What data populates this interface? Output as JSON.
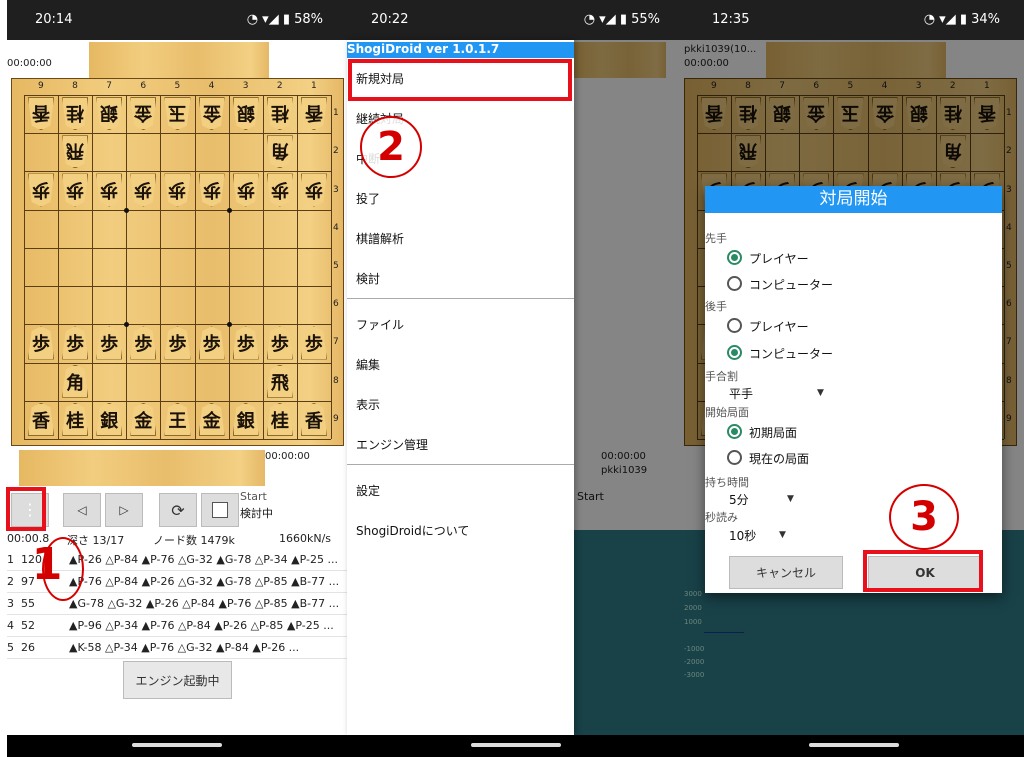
{
  "panel1": {
    "status_time": "20:14",
    "status_right": "◔ ▾◢ ▮ 58%",
    "top_clock": "00:00:00",
    "bottom_clock": "00:00:00",
    "analysis_status": "Start",
    "analysis_state": "検討中",
    "stats": {
      "time": "00:00.8",
      "depth": "深さ 13/17",
      "nodes": "ノード数 1479k",
      "nps": "1660kN/s"
    },
    "lines": [
      {
        "rank": "1",
        "score": "120",
        "moves": "▲P-26 △P-84 ▲P-76 △G-32 ▲G-78 △P-34 ▲P-25 ..."
      },
      {
        "rank": "2",
        "score": "97",
        "moves": "▲P-76 △P-84 ▲P-26 △G-32 ▲G-78 △P-85 ▲B-77 ..."
      },
      {
        "rank": "3",
        "score": "55",
        "moves": "▲G-78 △G-32 ▲P-26 △P-84 ▲P-76 △P-85 ▲B-77 ..."
      },
      {
        "rank": "4",
        "score": "52",
        "moves": "▲P-96 △P-34 ▲P-76 △P-84 ▲P-26 △P-85 ▲P-25 ..."
      },
      {
        "rank": "5",
        "score": "26",
        "moves": "▲K-58 △P-34 ▲P-76 △G-32 ▲P-84 ▲P-26 ..."
      }
    ],
    "engine_button": "エンジン起動中"
  },
  "panel2": {
    "status_time": "20:22",
    "status_right": "◔ ▾◢ ▮ 55%",
    "menu_title": "ShogiDroid ver 1.0.1.7",
    "menu_items": [
      "新規対局",
      "継続対局",
      "中断",
      "投了",
      "棋譜解析",
      "検討",
      "ファイル",
      "編集",
      "表示",
      "エンジン管理",
      "設定",
      "ShogiDroidについて"
    ],
    "bg_clock": "00:00:00",
    "bg_player": "pkki1039",
    "bg_status": "Start"
  },
  "panel3": {
    "status_time": "12:35",
    "status_right": "◔ ▾◢ ▮ 34%",
    "top_player": "pkki1039(10...",
    "top_clock": "00:00:00",
    "dialog": {
      "title": "対局開始",
      "sente_label": "先手",
      "sente_options": [
        "プレイヤー",
        "コンピューター"
      ],
      "gote_label": "後手",
      "gote_options": [
        "プレイヤー",
        "コンピューター"
      ],
      "handicap_label": "手合割",
      "handicap_value": "平手",
      "start_label": "開始局面",
      "start_options": [
        "初期局面",
        "現在の局面"
      ],
      "time_label": "持ち時間",
      "time_value": "5分",
      "byoyomi_label": "秒読み",
      "byoyomi_value": "10秒",
      "cancel": "キャンセル",
      "ok": "OK"
    },
    "graph_yticks": [
      "3000",
      "2000",
      "1000",
      "-1000",
      "-2000",
      "-3000"
    ]
  },
  "board": {
    "files": [
      "9",
      "8",
      "7",
      "6",
      "5",
      "4",
      "3",
      "2",
      "1"
    ],
    "ranks": [
      "1",
      "2",
      "3",
      "4",
      "5",
      "6",
      "7",
      "8",
      "9"
    ]
  },
  "callouts": [
    "1",
    "2",
    "3"
  ]
}
